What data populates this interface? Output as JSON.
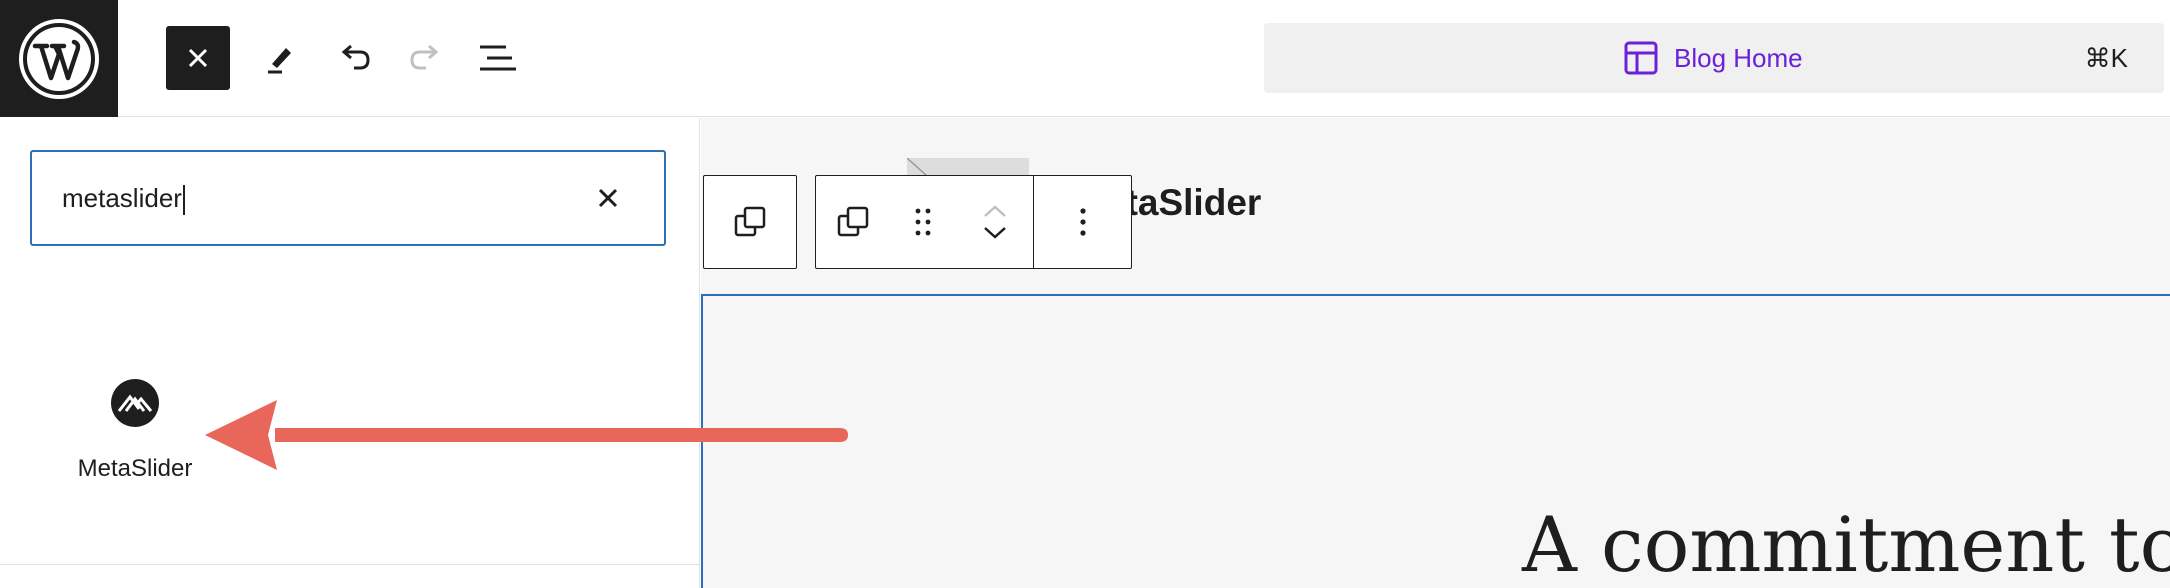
{
  "topbar": {
    "logo": "wordpress-icon",
    "buttons": [
      "close-icon",
      "pencil-icon",
      "undo-icon",
      "redo-icon",
      "list-view-icon"
    ]
  },
  "command_bar": {
    "title": "Blog Home",
    "icon": "layout-icon",
    "shortcut": "⌘K"
  },
  "inserter": {
    "search": {
      "value": "metaslider"
    },
    "results": [
      {
        "label": "MetaSlider",
        "icon": "metaslider-icon"
      }
    ]
  },
  "canvas": {
    "block_title": "etaSlider",
    "heading": "A commitment to i"
  },
  "colors": {
    "accent": "#6b21d9",
    "selection": "#2f6fb5",
    "arrow": "#e8665a",
    "dark": "#1e1e1e"
  }
}
